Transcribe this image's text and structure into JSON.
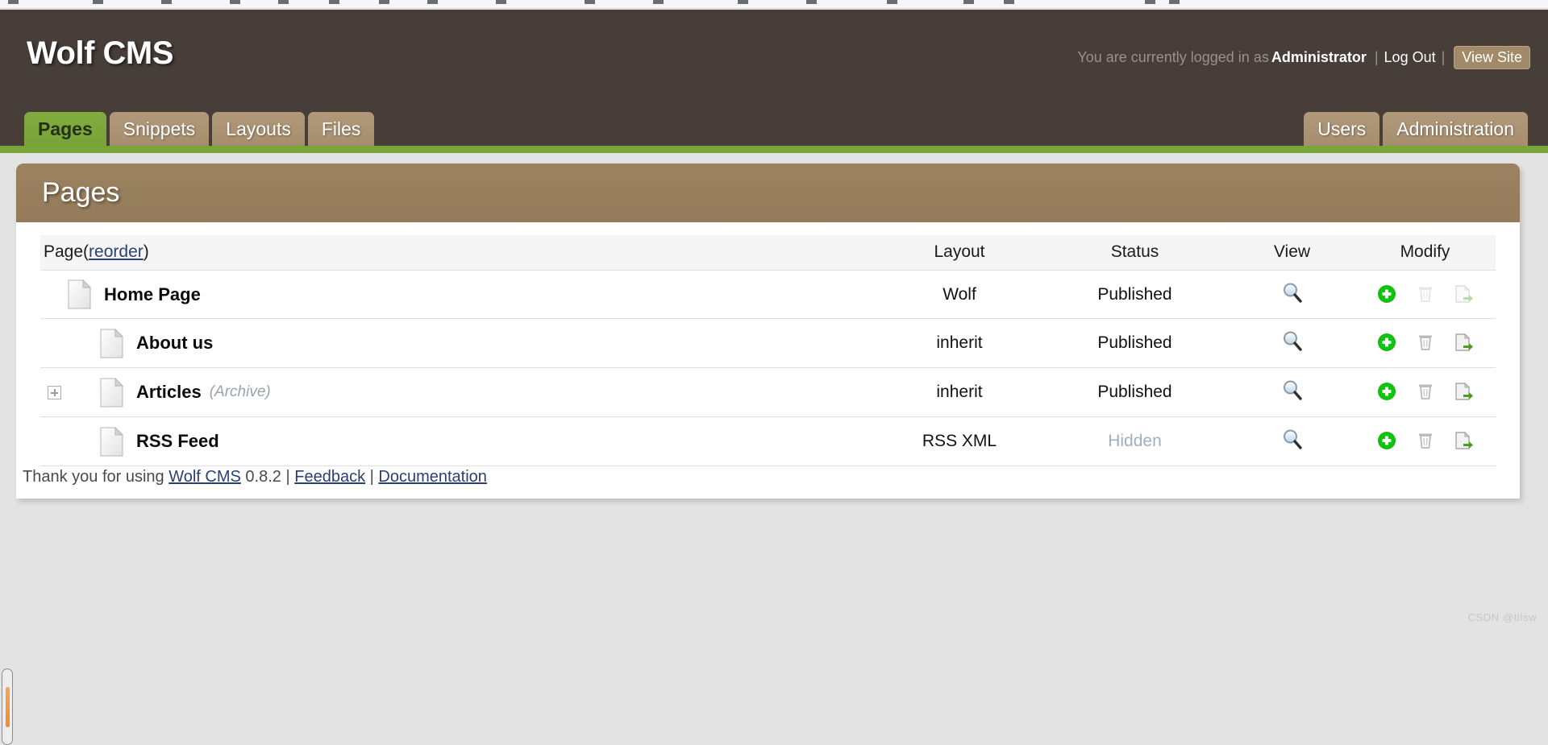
{
  "browser": {
    "bookmark_labels": [
      "",
      "",
      "",
      "",
      "",
      "",
      "",
      "",
      "",
      "",
      "",
      "",
      "",
      "",
      "",
      "",
      "",
      ""
    ]
  },
  "header": {
    "brand": "Wolf CMS",
    "login_prefix": "You are currently logged in as",
    "username": "Administrator",
    "separator": "|",
    "logout_label": "Log Out",
    "view_site_label": "View Site"
  },
  "tabs": {
    "left": [
      {
        "label": "Pages",
        "active": true
      },
      {
        "label": "Snippets",
        "active": false
      },
      {
        "label": "Layouts",
        "active": false
      },
      {
        "label": "Files",
        "active": false
      }
    ],
    "right": [
      {
        "label": "Users",
        "active": false
      },
      {
        "label": "Administration",
        "active": false
      }
    ]
  },
  "card": {
    "title": "Pages"
  },
  "table": {
    "headers": {
      "page": "Page",
      "page_reorder_open": "(",
      "page_reorder": "reorder",
      "page_reorder_close": ")",
      "layout": "Layout",
      "status": "Status",
      "view": "View",
      "modify": "Modify"
    },
    "rows": [
      {
        "name": "Home Page",
        "tag": "",
        "indent": 0,
        "expandable": false,
        "layout": "Wolf",
        "status": "Published",
        "status_hidden": false,
        "view_icon": "magnifier-icon",
        "actions": [
          {
            "icon": "add-page-icon",
            "dim": false
          },
          {
            "icon": "delete-page-icon",
            "dim": true
          },
          {
            "icon": "move-page-icon",
            "dim": true
          }
        ]
      },
      {
        "name": "About us",
        "tag": "",
        "indent": 1,
        "expandable": false,
        "layout": "inherit",
        "status": "Published",
        "status_hidden": false,
        "view_icon": "magnifier-icon",
        "actions": [
          {
            "icon": "add-page-icon",
            "dim": false
          },
          {
            "icon": "delete-page-icon",
            "dim": false
          },
          {
            "icon": "move-page-icon",
            "dim": false
          }
        ]
      },
      {
        "name": "Articles",
        "tag": "(Archive)",
        "indent": 1,
        "expandable": true,
        "layout": "inherit",
        "status": "Published",
        "status_hidden": false,
        "view_icon": "magnifier-icon",
        "actions": [
          {
            "icon": "add-page-icon",
            "dim": false
          },
          {
            "icon": "delete-page-icon",
            "dim": false
          },
          {
            "icon": "move-page-icon",
            "dim": false
          }
        ]
      },
      {
        "name": "RSS Feed",
        "tag": "",
        "indent": 1,
        "expandable": false,
        "layout": "RSS XML",
        "status": "Hidden",
        "status_hidden": true,
        "view_icon": "magnifier-icon",
        "actions": [
          {
            "icon": "add-page-icon",
            "dim": false
          },
          {
            "icon": "delete-page-icon",
            "dim": false
          },
          {
            "icon": "move-page-icon",
            "dim": false
          }
        ]
      }
    ]
  },
  "footer": {
    "thanks": "Thank you for using",
    "product_link": "Wolf CMS",
    "version": "0.8.2",
    "sep1": "|",
    "feedback_link": "Feedback",
    "sep2": "|",
    "documentation_link": "Documentation"
  },
  "watermark": "CSDN @tllsw",
  "colors": {
    "header_bg": "#473e39",
    "accent_green": "#79a437",
    "tab_tan": "#a68e6d",
    "card_header": "#937b5b",
    "link": "#2a3f72",
    "hidden_status": "#9fb0bd",
    "scroll_thumb": "#ef8a2c"
  }
}
